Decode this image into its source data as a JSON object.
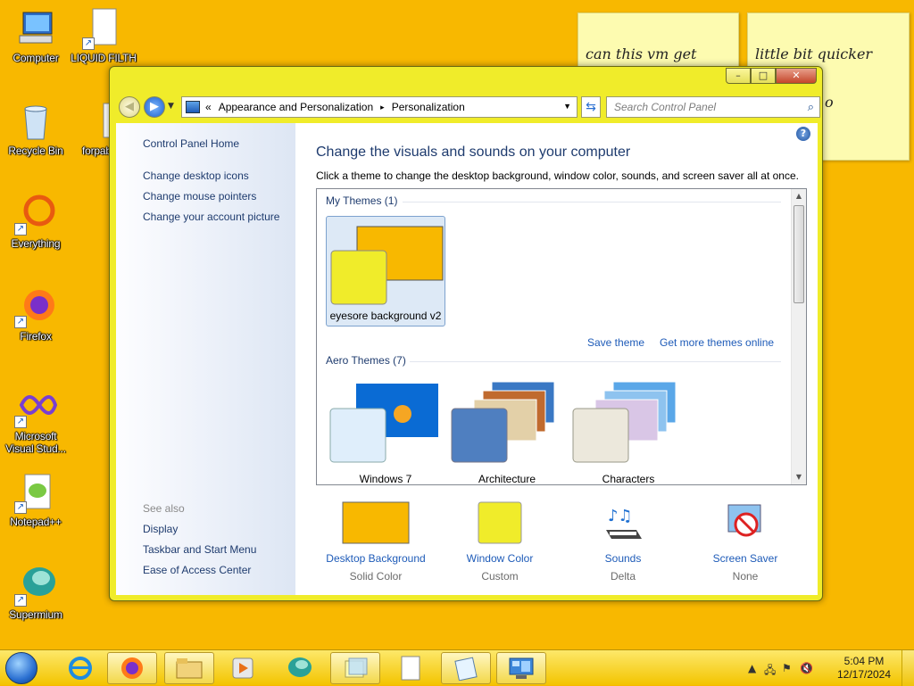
{
  "desktop": {
    "icons": [
      {
        "label": "Computer",
        "icon": "computer-icon"
      },
      {
        "label": "LIQUID FILTH",
        "icon": "document-icon"
      },
      {
        "label": "Recycle Bin",
        "icon": "recycle-bin-icon"
      },
      {
        "label": "forpab",
        "icon": "document-icon"
      },
      {
        "label": "Everything",
        "icon": "everything-icon"
      },
      {
        "label": "Firefox",
        "icon": "firefox-icon"
      },
      {
        "label": "Microsoft Visual Stud...",
        "icon": "visual-studio-icon"
      },
      {
        "label": "Notepad++",
        "icon": "notepad-plus-plus-icon"
      },
      {
        "label": "Supermium",
        "icon": "supermium-icon"
      }
    ],
    "sticky_notes": [
      {
        "text": "can this vm get"
      },
      {
        "text": "little bit quicker",
        "text2": "o"
      }
    ],
    "background_color": "#f8b800"
  },
  "window": {
    "caption": {
      "minimize": "–",
      "maximize": "□",
      "close": "✕"
    },
    "address": {
      "overflow": "«",
      "crumbs": [
        "Appearance and Personalization",
        "Personalization"
      ],
      "separator": "▸"
    },
    "search": {
      "placeholder": "Search Control Panel"
    },
    "left_pane": {
      "home": "Control Panel Home",
      "links": [
        "Change desktop icons",
        "Change mouse pointers",
        "Change your account picture"
      ],
      "see_also": "See also",
      "see_also_links": [
        "Display",
        "Taskbar and Start Menu",
        "Ease of Access Center"
      ]
    },
    "main": {
      "title": "Change the visuals and sounds on your computer",
      "subtitle": "Click a theme to change the desktop background, window color, sounds, and screen saver all at once.",
      "my_themes_header": "My Themes (1)",
      "my_themes": [
        {
          "name": "eyesore background v2",
          "selected": true
        }
      ],
      "save_theme": "Save theme",
      "get_more": "Get more themes online",
      "aero_header": "Aero Themes (7)",
      "aero_themes": [
        {
          "name": "Windows 7"
        },
        {
          "name": "Architecture"
        },
        {
          "name": "Characters"
        }
      ]
    },
    "bottom": [
      {
        "label": "Desktop Background",
        "value": "Solid Color",
        "icon": "desktop-background-icon"
      },
      {
        "label": "Window Color",
        "value": "Custom",
        "icon": "window-color-icon"
      },
      {
        "label": "Sounds",
        "value": "Delta",
        "icon": "sounds-icon"
      },
      {
        "label": "Screen Saver",
        "value": "None",
        "icon": "screen-saver-icon"
      }
    ],
    "colors": {
      "frame": "#f0ec2a",
      "desktop_swatch": "#f8b800",
      "window_swatch": "#f0ec2a"
    }
  },
  "taskbar": {
    "buttons": [
      "start-orb-icon",
      "internet-explorer-icon",
      "firefox-icon",
      "file-explorer-icon",
      "media-player-icon",
      "supermium-icon",
      "sticky-notes-icon",
      "notepad-icon",
      "control-panel-icon"
    ],
    "clock": {
      "time": "5:04 PM",
      "date": "12/17/2024"
    }
  }
}
